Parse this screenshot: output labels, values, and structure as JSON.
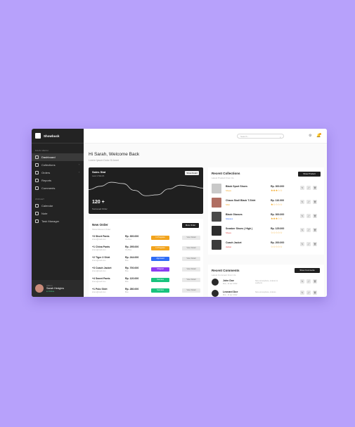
{
  "app": {
    "brand": "Showbuck"
  },
  "sidebar": {
    "main_menu_label": "MAIN MENU",
    "main_items": [
      {
        "label": "Dashboard",
        "active": true
      },
      {
        "label": "Collections",
        "chevron": "›"
      },
      {
        "label": "Orders",
        "chevron": "›"
      },
      {
        "label": "Reports"
      },
      {
        "label": "Comments"
      }
    ],
    "widget_label": "WIDGET",
    "widget_items": [
      {
        "label": "Calendar"
      },
      {
        "label": "Note"
      },
      {
        "label": "Task Manager"
      }
    ],
    "user": {
      "role": "Admin",
      "name": "Sarah Hedgins",
      "status": "● Online"
    }
  },
  "topbar": {
    "search_placeholder": "Search...",
    "search_icon": "⌕",
    "settings_icon": "⚙",
    "bell_icon": "🔔"
  },
  "header": {
    "greeting": "Hi Sarah, Welcome Back",
    "subtitle": "Lorem Ipsum Dolor Si Amet"
  },
  "sales_stat": {
    "title": "Sales Stat",
    "period": "Last 1 Month",
    "button": "Show Detail",
    "value": "120 +",
    "label": "Succesed Order",
    "chart_data": {
      "type": "line",
      "values": [
        0.45,
        0.6,
        0.78,
        0.72,
        0.42,
        0.18,
        0.22,
        0.48,
        0.65,
        0.6,
        0.52
      ]
    }
  },
  "new_order": {
    "title": "New Order",
    "subtitle": "Show Recent Order",
    "button": "More Order",
    "rows": [
      {
        "name": "+3 Short Pants",
        "sub": "lorem@mail.com",
        "price": "Rp. 300.000",
        "method": "Via Bca",
        "status": "In Progress",
        "status_color": "#f2a41d",
        "detail": "View Detail"
      },
      {
        "name": "+1 China Pants",
        "sub": "lorem@mail.com",
        "price": "Rp. 295.000",
        "method": "Via Bca",
        "status": "In Progress",
        "status_color": "#f2a41d",
        "detail": "View Detail"
      },
      {
        "name": "+2 Tiger 3 Shirt",
        "sub": "lorem@mail.com",
        "price": "Rp. 244.000",
        "method": "Bca",
        "status": "Approved",
        "status_color": "#2f6df6",
        "detail": "View Detail"
      },
      {
        "name": "+3 Coach Jacket",
        "sub": "lorem@mail.com",
        "price": "Rp. 700.000",
        "method": "Bca",
        "status": "Shipped",
        "status_color": "#8c3df2",
        "detail": "View Detail"
      },
      {
        "name": "+4 Sweet Pants",
        "sub": "lorem@mail.com",
        "price": "Rp. 120.000",
        "method": "Bca",
        "status": "Success",
        "status_color": "#19c37d",
        "detail": "View Detail"
      },
      {
        "name": "+1 Polo Shirt",
        "sub": "lorem@mail.com",
        "price": "Rp. 280.000",
        "method": "Bca",
        "status": "Success",
        "status_color": "#19c37d",
        "detail": "View Detail"
      }
    ]
  },
  "collections": {
    "title": "Recent Collections",
    "subtitle": "Latest Product From Us",
    "button": "Show Product",
    "rows": [
      {
        "name": "Black Sport Shoes",
        "category": "Shoes",
        "cat_color": "#f2a41d",
        "price": "Rp. 300.000",
        "stars": "★★★☆☆",
        "img": "#c9c9c9"
      },
      {
        "name": "Chaos Skull Black T-Shirt",
        "category": "Shirt",
        "cat_color": "#f2a41d",
        "price": "Rp. 110.000",
        "stars": "★☆☆☆☆",
        "img": "#b06e62"
      },
      {
        "name": "Black Glasses",
        "category": "Glasses",
        "cat_color": "#2f6df6",
        "price": "Rp. 300.000",
        "stars": "★★★☆☆",
        "img": "#4a4a4a"
      },
      {
        "name": "Sneaker Shoes ( High )",
        "category": "Shoes",
        "cat_color": "#e24545",
        "price": "Rp. 125.000",
        "stars": "☆☆☆☆☆",
        "img": "#2d2d2d"
      },
      {
        "name": "Coach Jacket",
        "category": "Jacket",
        "cat_color": "#e24545",
        "price": "Rp. 200.000",
        "stars": "☆☆☆☆☆",
        "img": "#3a3a3a"
      }
    ],
    "action_icons": [
      "✎",
      "⤢",
      "🗑"
    ]
  },
  "comments": {
    "title": "Recent Comments",
    "subtitle": "Latest Comment From Us",
    "button": "Show Comments",
    "rows": [
      {
        "name": "John Doe",
        "date": "Mon, 14 Apr 2022",
        "text": "Nice atmosphere, indoors & outdoors"
      },
      {
        "name": "Leonard Doe",
        "date": "Mon, 14 Apr 2022",
        "text": "Nice atmosphere, indoors"
      }
    ]
  }
}
